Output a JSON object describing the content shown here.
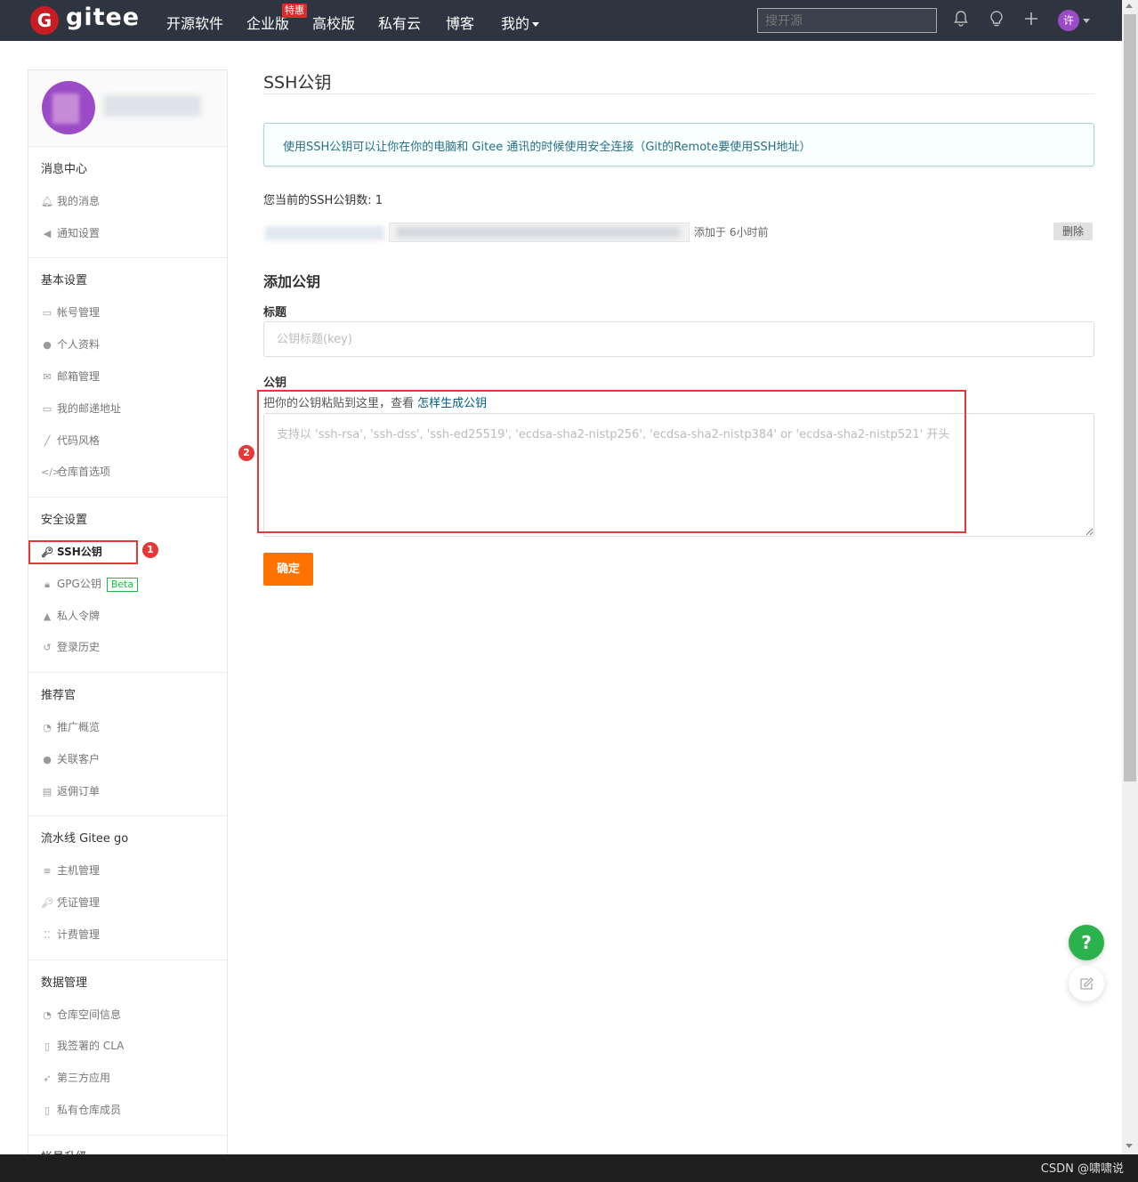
{
  "nav": {
    "logo_text": "gitee",
    "items": [
      "开源软件",
      "企业版",
      "高校版",
      "私有云",
      "博客",
      "我的"
    ],
    "enterprise_badge": "特惠",
    "search_placeholder": "搜开源",
    "user_initial": "许"
  },
  "sidebar": {
    "sections": [
      {
        "title": "消息中心",
        "items": [
          "我的消息",
          "通知设置"
        ]
      },
      {
        "title": "基本设置",
        "items": [
          "帐号管理",
          "个人资料",
          "邮箱管理",
          "我的邮递地址",
          "代码风格",
          "仓库首选项"
        ]
      },
      {
        "title": "安全设置",
        "items": [
          "SSH公钥",
          "GPG公钥",
          "私人令牌",
          "登录历史"
        ],
        "beta_label": "Beta"
      },
      {
        "title": "推荐官",
        "items": [
          "推广概览",
          "关联客户",
          "返佣订单"
        ]
      },
      {
        "title": "流水线 Gitee go",
        "items": [
          "主机管理",
          "凭证管理",
          "计费管理"
        ]
      },
      {
        "title": "数据管理",
        "items": [
          "仓库空间信息",
          "我签署的 CLA",
          "第三方应用",
          "私有仓库成员"
        ]
      },
      {
        "title": "帐号升级",
        "items": []
      }
    ]
  },
  "main": {
    "title": "SSH公钥",
    "info": "使用SSH公钥可以让你在你的电脑和 Gitee 通讯的时候使用安全连接（Git的Remote要使用SSH地址）",
    "key_count": "您当前的SSH公钥数: 1",
    "key_added": "添加于 6小时前",
    "delete_label": "删除",
    "add_title": "添加公钥",
    "title_label": "标题",
    "title_placeholder": "公钥标题(key)",
    "key_label": "公钥",
    "hint_text": "把你的公钥粘贴到这里，查看 ",
    "hint_link": "怎样生成公钥",
    "key_placeholder": "支持以 'ssh-rsa', 'ssh-dss', 'ssh-ed25519', 'ecdsa-sha2-nistp256', 'ecdsa-sha2-nistp384' or 'ecdsa-sha2-nistp521' 开头",
    "submit_label": "确定"
  },
  "annotations": {
    "marker1": "1",
    "marker2": "2"
  },
  "floating": {
    "help": "?"
  },
  "watermark": "CSDN @啸啸说",
  "colors": {
    "nav_bg": "#2e3440",
    "brand_red": "#c71d23",
    "submit_orange": "#fe7300",
    "annotation_red": "#e53838",
    "help_green": "#2bb24c"
  }
}
